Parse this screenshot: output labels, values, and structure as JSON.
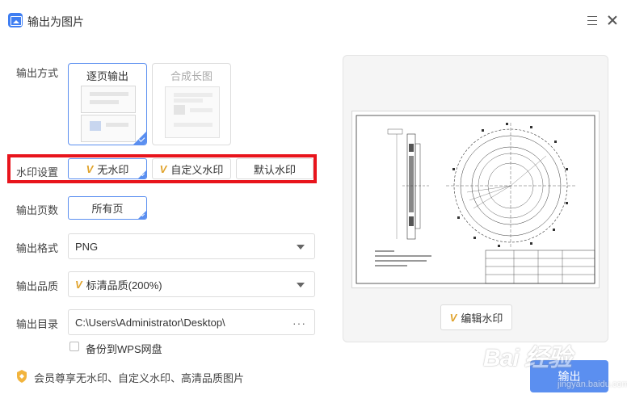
{
  "window": {
    "title": "输出为图片"
  },
  "labels": {
    "output_mode": "输出方式",
    "watermark": "水印设置",
    "pages": "输出页数",
    "format": "输出格式",
    "quality": "输出品质",
    "directory": "输出目录"
  },
  "output_mode": {
    "options": [
      "逐页输出",
      "合成长图"
    ],
    "selected": "逐页输出"
  },
  "watermark": {
    "options": [
      "无水印",
      "自定义水印",
      "默认水印"
    ],
    "selected": "无水印"
  },
  "pages": {
    "option": "所有页"
  },
  "format": {
    "value": "PNG"
  },
  "quality": {
    "value": "标清品质(200%)"
  },
  "directory": {
    "value": "C:\\Users\\Administrator\\Desktop\\",
    "more": "···"
  },
  "backup": {
    "label": "备份到WPS网盘",
    "checked": false
  },
  "member_notice": "会员尊享无水印、自定义水印、高清品质图片",
  "preview": {
    "edit_watermark_label": "编辑水印"
  },
  "export_label": "输出",
  "premium_mark": "V",
  "watermark_overlay": {
    "text": "Bai 经验",
    "sub": "jingyan.baidu.com"
  },
  "colors": {
    "accent": "#5b8ff0",
    "highlight": "#e8141c",
    "premium": "#e0a32c"
  }
}
